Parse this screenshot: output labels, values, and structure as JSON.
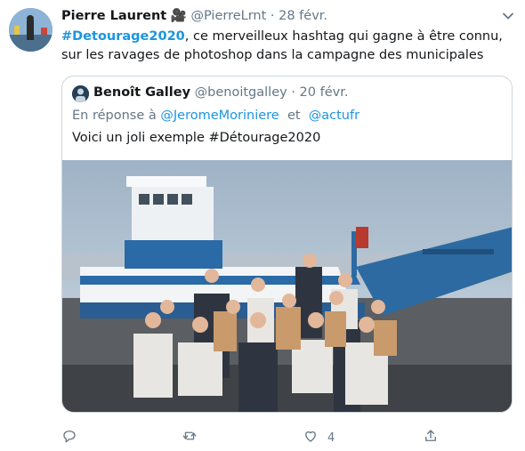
{
  "tweet": {
    "author_name": "Pierre Laurent",
    "author_emoji": "🎥",
    "handle": "@PierreLrnt",
    "separator": "·",
    "date": "28 févr.",
    "hashtag": "#Detourage2020",
    "text_rest": ", ce merveilleux hashtag qui gagne à être connu, sur les ravages de photoshop dans la campagne des municipales"
  },
  "quoted": {
    "author_name": "Benoît Galley",
    "handle": "@benoitgalley",
    "separator": "·",
    "date": "20 févr.",
    "reply_prefix": "En réponse à",
    "reply_mention_1": "@JeromeMoriniere",
    "reply_joiner": "et",
    "reply_mention_2": "@actufr",
    "text": "Voici un joli exemple #Détourage2020",
    "image_content": "group-photo-in-front-of-ferry"
  },
  "actions": {
    "reply_icon": "reply-icon",
    "retweet_icon": "retweet-icon",
    "like_icon": "heart-icon",
    "like_count": "4",
    "share_icon": "share-icon"
  },
  "colors": {
    "link": "#1b95e0",
    "muted": "#657786",
    "text": "#14171a",
    "border": "#cdd6dd"
  }
}
